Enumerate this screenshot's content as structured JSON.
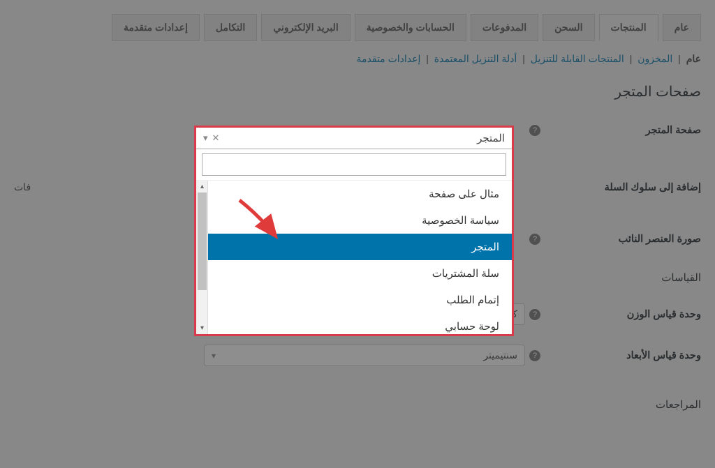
{
  "tabs": {
    "general": "عام",
    "products": "المنتجات",
    "shipping": "السحن",
    "payments": "المدفوعات",
    "accounts": "الحسابات والخصوصية",
    "emails": "البريد الإلكتروني",
    "integration": "التكامل",
    "advanced": "إعدادات متقدمة"
  },
  "subnav": {
    "general": "عام",
    "inventory": "المخزون",
    "downloadable": "المنتجات القابلة للتنزيل",
    "download_dirs": "أدلة التنزيل المعتمدة",
    "advanced": "إعدادات متقدمة"
  },
  "sections": {
    "shop_pages": "صفحات المتجر",
    "measurements": "القياسات",
    "reviews": "المراجعات"
  },
  "rows": {
    "shop_page": "صفحة المتجر",
    "add_to_cart": "إضافة إلى سلوك السلة",
    "placeholder_image": "صورة العنصر النائب",
    "weight_unit": "وحدة قياس الوزن",
    "dimensions_unit": "وحدة قياس الأبعاد"
  },
  "values": {
    "weight_unit": "كيلوجرام",
    "dimensions_unit": "سنتيميتر",
    "add_to_cart_text": "فات"
  },
  "dropdown": {
    "selected": "المتجر",
    "search_placeholder": "",
    "options": {
      "example_page": "مثال على صفحة",
      "privacy": "سياسة الخصوصية",
      "shop": "المتجر",
      "cart": "سلة المشتريات",
      "checkout": "إتمام الطلب",
      "account": "لوحة حسابي"
    }
  }
}
